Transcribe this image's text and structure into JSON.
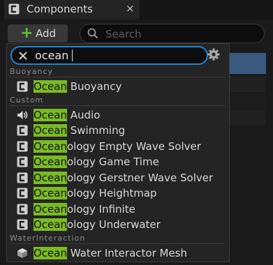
{
  "tab": {
    "title": "Components",
    "close_glyph": "×",
    "icon": "component-icon"
  },
  "toolbar": {
    "add_label": "Add",
    "add_glyph": "+"
  },
  "search": {
    "placeholder": "Search",
    "icon": "search-icon"
  },
  "filter": {
    "query": "ocean",
    "clear_icon": "close-icon",
    "settings_icon": "gear-icon"
  },
  "colors": {
    "highlight": "#7bbb22",
    "focus_border": "#1f84d8",
    "add_plus": "#5fbf2e",
    "selected_row": "#3b5a80"
  },
  "categories": [
    {
      "name": "Buoyancy",
      "items": [
        {
          "match": "Ocean",
          "rest": " Buoyancy",
          "icon": "component-icon"
        }
      ]
    },
    {
      "name": "Custom",
      "items": [
        {
          "match": "Ocean",
          "rest": " Audio",
          "icon": "speaker-icon"
        },
        {
          "match": "Ocean",
          "rest": " Swimming",
          "icon": "component-icon"
        },
        {
          "match": "Ocean",
          "rest": "ology Empty Wave Solver",
          "icon": "component-icon"
        },
        {
          "match": "Ocean",
          "rest": "ology Game Time",
          "icon": "component-icon"
        },
        {
          "match": "Ocean",
          "rest": "ology Gerstner Wave Solver",
          "icon": "component-icon"
        },
        {
          "match": "Ocean",
          "rest": "ology Heightmap",
          "icon": "component-icon"
        },
        {
          "match": "Ocean",
          "rest": "ology Infinite",
          "icon": "component-icon"
        },
        {
          "match": "Ocean",
          "rest": "ology Underwater",
          "icon": "component-icon"
        }
      ]
    },
    {
      "name": "WaterInteraction",
      "items": [
        {
          "match": "Ocean",
          "rest": " Water Interactor Mesh",
          "icon": "mesh-icon"
        }
      ]
    }
  ]
}
